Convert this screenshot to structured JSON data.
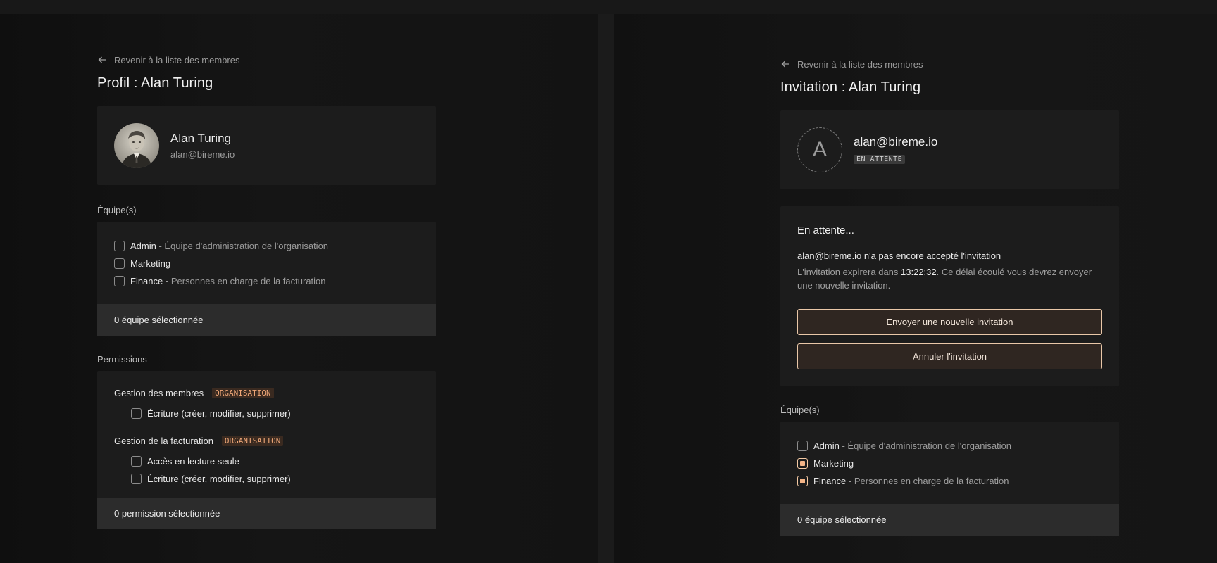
{
  "left": {
    "back_label": "Revenir à la liste des membres",
    "title": "Profil : Alan Turing",
    "profile": {
      "name": "Alan Turing",
      "email": "alan@bireme.io"
    },
    "teams_label": "Équipe(s)",
    "teams": [
      {
        "name": "Admin",
        "sep": " - ",
        "desc": "Équipe d'administration de l'organisation",
        "checked": false
      },
      {
        "name": "Marketing",
        "sep": "",
        "desc": "",
        "checked": false
      },
      {
        "name": "Finance",
        "sep": " - ",
        "desc": "Personnes en charge de la facturation",
        "checked": false
      }
    ],
    "teams_footer": "0 équipe sélectionnée",
    "permissions_label": "Permissions",
    "permission_groups": [
      {
        "title": "Gestion des membres",
        "badge": "ORGANISATION",
        "items": [
          "Écriture (créer, modifier, supprimer)"
        ]
      },
      {
        "title": "Gestion de la facturation",
        "badge": "ORGANISATION",
        "items": [
          "Accès en lecture seule",
          "Écriture (créer, modifier, supprimer)"
        ]
      }
    ],
    "permissions_footer": "0 permission sélectionnée"
  },
  "right": {
    "back_label": "Revenir à la liste des membres",
    "title": "Invitation : Alan Turing",
    "invite": {
      "initial": "A",
      "email": "alan@bireme.io",
      "status": "EN ATTENTE"
    },
    "pending": {
      "title": "En attente...",
      "line1": "alan@bireme.io n'a pas encore accepté l'invitation",
      "line2_before": "L'invitation expirera dans ",
      "countdown": "13:22:32",
      "line2_after": ". Ce délai écoulé vous devrez envoyer une nouvelle invitation.",
      "resend_button": "Envoyer une nouvelle invitation",
      "cancel_button": "Annuler l'invitation"
    },
    "teams_label": "Équipe(s)",
    "teams": [
      {
        "name": "Admin",
        "sep": " - ",
        "desc": "Équipe d'administration de l'organisation",
        "checked": false
      },
      {
        "name": "Marketing",
        "sep": "",
        "desc": "",
        "checked": true
      },
      {
        "name": "Finance",
        "sep": " - ",
        "desc": "Personnes en charge de la facturation",
        "checked": true
      }
    ],
    "teams_footer": "0 équipe sélectionnée"
  },
  "colors": {
    "accent": "#f4b487",
    "accent_border": "#e9c7a8",
    "badge_text": "#f0a878"
  },
  "icons": {
    "back": "arrow-left-icon",
    "checkbox": "checkbox-icon"
  }
}
